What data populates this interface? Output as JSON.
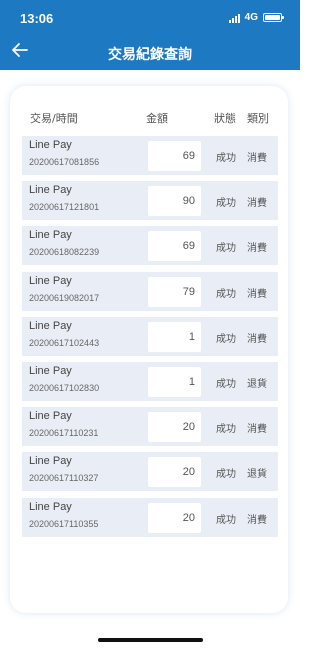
{
  "statusbar": {
    "time": "13:06",
    "network": "4G"
  },
  "header": {
    "title": "交易紀錄查詢",
    "back_icon": "arrow-left-icon",
    "bg_color": "#1d7ac2"
  },
  "table": {
    "columns": {
      "transaction": "交易/時間",
      "amount": "金額",
      "status": "狀態",
      "type": "類別"
    },
    "rows": [
      {
        "merchant": "Line Pay",
        "id": "20200617081856",
        "amount": "69",
        "status": "成功",
        "type": "消費"
      },
      {
        "merchant": "Line Pay",
        "id": "20200617121801",
        "amount": "90",
        "status": "成功",
        "type": "消費"
      },
      {
        "merchant": "Line Pay",
        "id": "20200618082239",
        "amount": "69",
        "status": "成功",
        "type": "消費"
      },
      {
        "merchant": "Line Pay",
        "id": "20200619082017",
        "amount": "79",
        "status": "成功",
        "type": "消費"
      },
      {
        "merchant": "Line Pay",
        "id": "20200617102443",
        "amount": "1",
        "status": "成功",
        "type": "消費"
      },
      {
        "merchant": "Line Pay",
        "id": "20200617102830",
        "amount": "1",
        "status": "成功",
        "type": "退貨"
      },
      {
        "merchant": "Line Pay",
        "id": "20200617110231",
        "amount": "20",
        "status": "成功",
        "type": "消費"
      },
      {
        "merchant": "Line Pay",
        "id": "20200617110327",
        "amount": "20",
        "status": "成功",
        "type": "退貨"
      },
      {
        "merchant": "Line Pay",
        "id": "20200617110355",
        "amount": "20",
        "status": "成功",
        "type": "消費"
      }
    ]
  }
}
